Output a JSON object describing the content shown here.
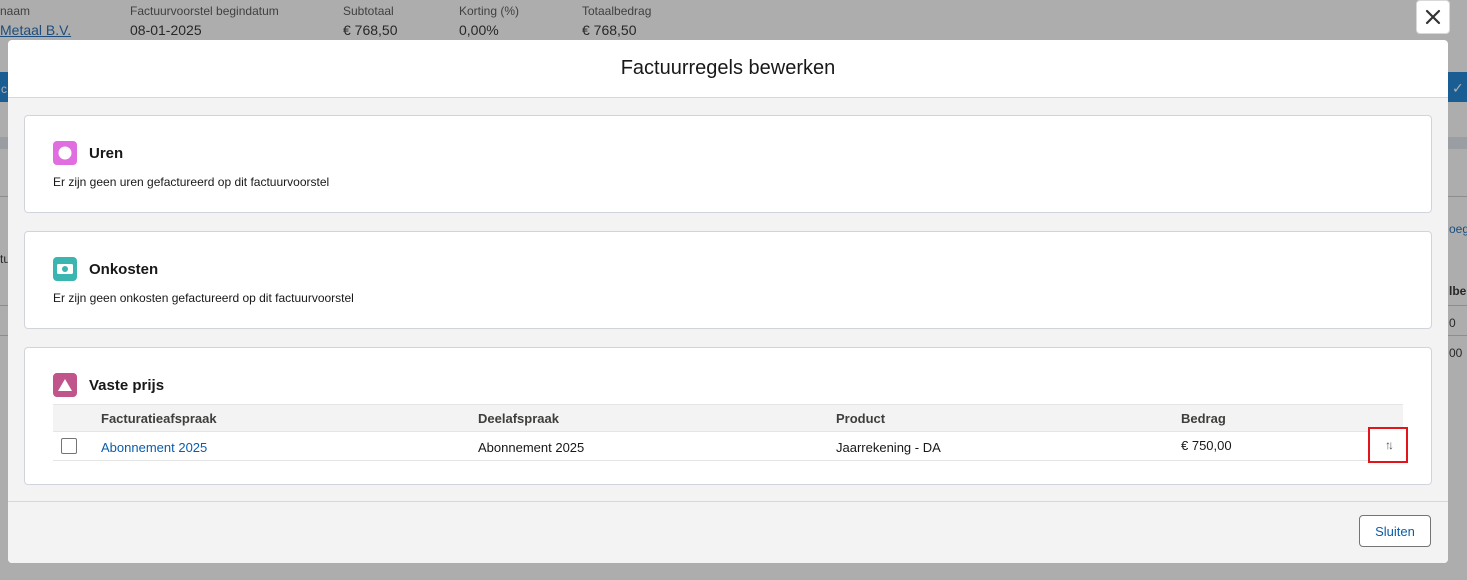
{
  "background": {
    "fields": [
      {
        "label": "naam",
        "value": "Metaal B.V.",
        "link": true
      },
      {
        "label": "Factuurvoorstel begindatum",
        "value": "08-01-2025",
        "link": false
      },
      {
        "label": "Subtotaal",
        "value": "€ 768,50",
        "link": false
      },
      {
        "label": "Korting (%)",
        "value": "0,00%",
        "link": false
      },
      {
        "label": "Totaalbedrag",
        "value": "€ 768,50",
        "link": false
      }
    ],
    "side_text_1": "c",
    "side_text_2": "tu",
    "side_link": "oeg",
    "side_col_header": "lbe",
    "side_val_1": "0",
    "side_val_2": "00"
  },
  "modal": {
    "title": "Factuurregels bewerken",
    "close_icon": "close-icon",
    "sections": {
      "uren": {
        "title": "Uren",
        "icon": "clock-icon",
        "icon_color": "#e06ee0",
        "empty_text": "Er zijn geen uren gefactureerd op dit factuurvoorstel"
      },
      "onkosten": {
        "title": "Onkosten",
        "icon": "money-icon",
        "icon_color": "#3bb5b0",
        "empty_text": "Er zijn geen onkosten gefactureerd op dit factuurvoorstel"
      },
      "vaste_prijs": {
        "title": "Vaste prijs",
        "icon": "triangle-icon",
        "icon_color": "#c0558c",
        "columns": [
          "Facturatieafspraak",
          "Deelafspraak",
          "Product",
          "Bedrag"
        ],
        "rows": [
          {
            "facturatieafspraak": "Abonnement 2025",
            "deelafspraak": "Abonnement 2025",
            "product": "Jaarrekening - DA",
            "bedrag": "€ 750,00",
            "checked": false
          }
        ]
      }
    },
    "footer": {
      "close_label": "Sluiten"
    }
  }
}
